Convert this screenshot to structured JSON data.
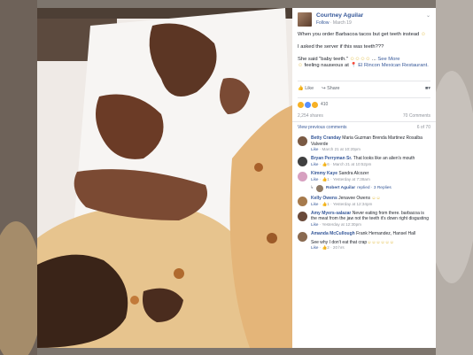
{
  "post": {
    "author": "Courtney Aguilar",
    "follow": "Follow",
    "date": "March 19",
    "line1": "When you order Barbacoa tacos but get teeth instead",
    "line2": "I asked the server if this was teeth???",
    "line3": "She said \"baby teeth.\"",
    "see_more": "See More",
    "feeling": "feeling nauseous at",
    "place": "El Rincon Mexican Restaurant."
  },
  "actions": {
    "like": "Like",
    "share": "Share"
  },
  "reactions": {
    "count": "410"
  },
  "stats": {
    "shares": "2,254 shares",
    "comments": "70 Comments"
  },
  "prev": {
    "label": "View previous comments",
    "range": "6 of 70"
  },
  "comments": [
    {
      "name": "Betty Cranday",
      "text": "Maria Guzman Brenda Martinez Rosalba Valverde",
      "meta_like": "Like",
      "meta_time": "March 21 at 10:20pm",
      "avatar_color": "#7a5a44"
    },
    {
      "name": "Bryan Perryman Sr.",
      "text": "That looks like an alien's mouth",
      "meta_like": "Like",
      "meta_count": "6",
      "meta_time": "March 21 at 10:52pm",
      "avatar_color": "#404040"
    },
    {
      "name": "Kimmy Kaye",
      "text": "Sandra Alcozer",
      "meta_like": "Like",
      "meta_count": "1",
      "meta_time": "Yesterday at 7:38am",
      "avatar_color": "#d7a0c0"
    },
    {
      "name": "Kelly Owens",
      "text": "Jenavee Owens",
      "meta_like": "Like",
      "meta_count": "1",
      "meta_time": "Yesterday at 12:34pm",
      "avatar_color": "#a67a4c"
    },
    {
      "name": "Amy Myers-salazar",
      "text": "Never eating from there. barbacoa is the meat from the jaw not the teeth it's down right disgusting",
      "meta_like": "Like",
      "meta_time": "Yesterday at 12:30pm",
      "avatar_color": "#6a4a3a"
    },
    {
      "name": "Amanda McCullough",
      "text": "Frank Hernandez, Hansel Hall",
      "text2": "See why I don't eat that crap",
      "meta_like": "Like",
      "meta_count": "2",
      "meta_time": "20 hrs",
      "avatar_color": "#8a6a50"
    }
  ],
  "reply": {
    "name": "Robert Aguilar",
    "text": "replied · 3 Replies"
  }
}
